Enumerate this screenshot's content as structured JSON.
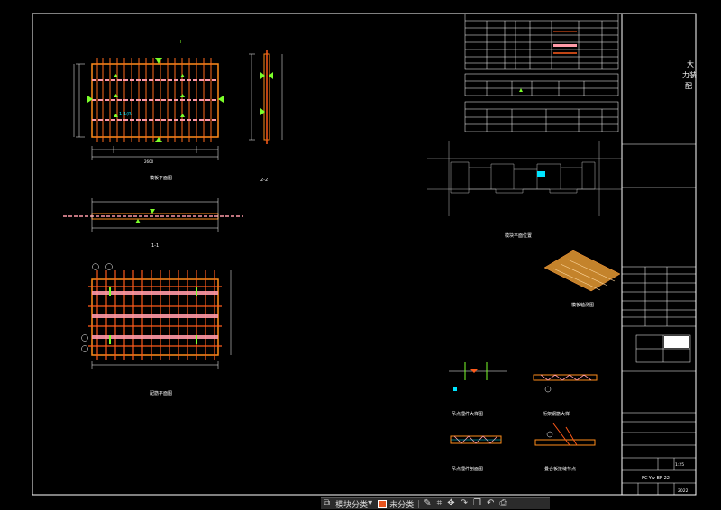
{
  "titleblock": {
    "company_line1": "大",
    "company_line2": "力装",
    "company_line3": "配",
    "project_code": "PC-Yw-BF-22",
    "sheet_no": "2022",
    "scale": "1:25"
  },
  "toolbar": {
    "layer_label": "模块分类",
    "color_label": "未分类",
    "accent": "#e8541e",
    "icons": [
      "layers-icon",
      "dropdown-icon",
      "edit-icon",
      "measure-icon",
      "move-icon",
      "redo-icon",
      "copy-icon",
      "undo-icon",
      "print-icon",
      "share-icon"
    ]
  },
  "colors": {
    "background": "#000000",
    "line_white": "#ffffff",
    "line_orange": "#ff7a1a",
    "line_yellow": "#ffe600",
    "line_green": "#39ff14",
    "line_pink": "#ff9aa8",
    "line_cyan": "#00e5ff"
  }
}
